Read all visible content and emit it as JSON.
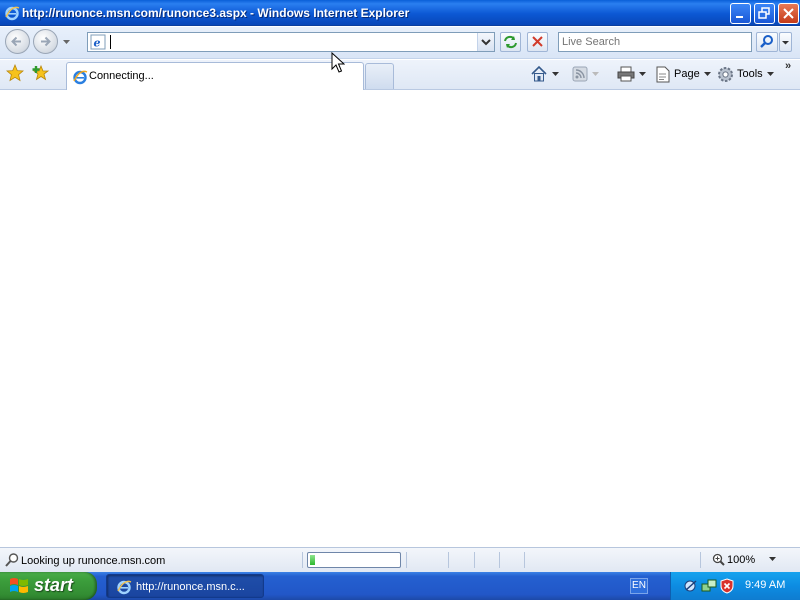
{
  "window": {
    "title": "http://runonce.msn.com/runonce3.aspx - Windows Internet Explorer",
    "icon": "ie-icon"
  },
  "address_bar": {
    "value": "",
    "page_icon": "ie-page-icon"
  },
  "search": {
    "placeholder": "Live Search"
  },
  "tabs": [
    {
      "label": "Connecting..."
    }
  ],
  "command_bar": {
    "page_label": "Page",
    "tools_label": "Tools"
  },
  "status_bar": {
    "text": "Looking up runonce.msn.com",
    "progress": 0.06,
    "zoom": "100%"
  },
  "taskbar": {
    "start_label": "start",
    "task_item_label": "http://runonce.msn.c...",
    "language": "EN",
    "clock": "9:49 AM"
  },
  "colors": {
    "titlebar": "#0c58d4",
    "taskbar": "#2257c8",
    "start_button": "#3c9e3c",
    "tray": "#0d8ce2"
  }
}
